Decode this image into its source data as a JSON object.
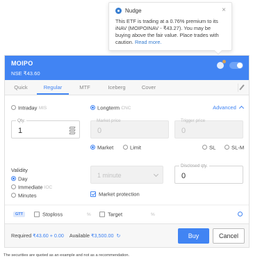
{
  "nudge": {
    "title": "Nudge",
    "message": "This ETF is trading at a 0.76% premium to its iNAV (MOIPOINAV - ₹43.27). You may be buying above the fair value. Place trades with caution.",
    "link": "Read more."
  },
  "header": {
    "symbol": "MOIPO",
    "exchange_price": "NSE  ₹43.60"
  },
  "tabs": [
    "Quick",
    "Regular",
    "MTF",
    "Iceberg",
    "Cover"
  ],
  "active_tab": "Regular",
  "product": {
    "intraday": "Intraday",
    "intraday_code": "MIS",
    "longterm": "Longterm",
    "longterm_code": "CNC",
    "advanced": "Advanced"
  },
  "qty": {
    "label": "Qty.",
    "value": "1"
  },
  "market_price": {
    "label": "Market price",
    "value": "0"
  },
  "trigger_price": {
    "label": "Trigger price",
    "value": "0"
  },
  "order_types": {
    "market": "Market",
    "limit": "Limit",
    "sl": "SL",
    "slm": "SL-M"
  },
  "validity": {
    "label": "Validity",
    "day": "Day",
    "immediate": "Immediate",
    "immediate_code": "IOC",
    "minutes": "Minutes"
  },
  "minutes_select": {
    "value": "1 minute"
  },
  "disclosed_qty": {
    "label": "Disclosed qty.",
    "value": "0"
  },
  "market_protection": "Market protection",
  "gtt": {
    "badge": "GTT",
    "stoploss": "Stoploss",
    "target": "Target",
    "percent": "%"
  },
  "footer": {
    "required_label": "Required",
    "required_value": "₹43.60 + 0.00",
    "available_label": "Available",
    "available_value": "₹3,500.00",
    "buy": "Buy",
    "cancel": "Cancel"
  },
  "disclaimer": "The securities are quoted as an example and not as a recommendation.",
  "colors": {
    "accent": "#4184f3",
    "header_bg": "#4184f3"
  }
}
